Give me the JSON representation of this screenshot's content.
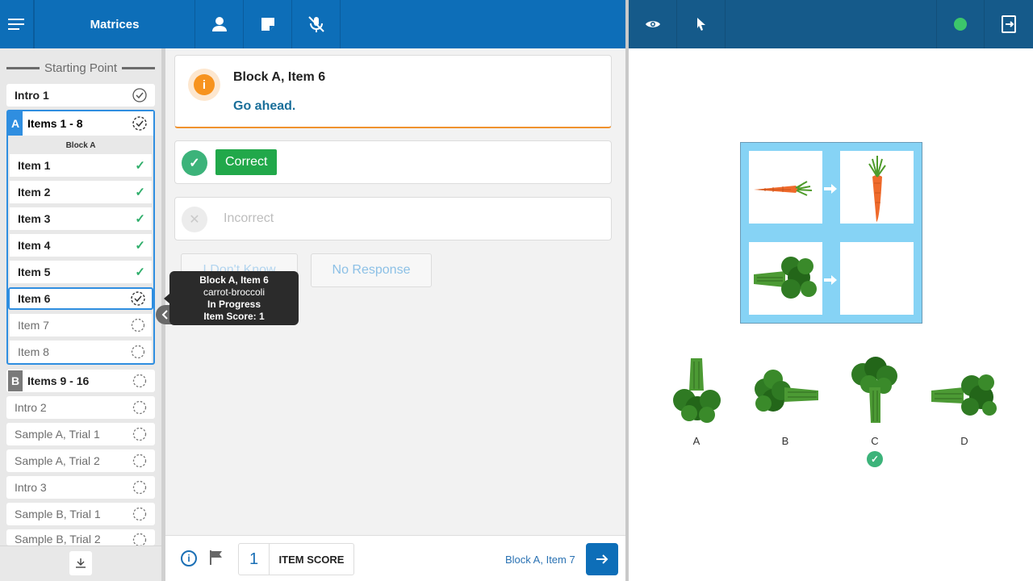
{
  "header": {
    "title": "Matrices",
    "icons": [
      "menu-icon",
      "person-icon",
      "note-icon",
      "mic-off-icon"
    ],
    "right_icons": [
      "eye-icon",
      "pointer-icon",
      "status-dot",
      "exit-icon"
    ],
    "status_color": "#3cc66b"
  },
  "sidebar": {
    "starting_point": "Starting Point",
    "intro1": "Intro 1",
    "blockA": {
      "letter": "A",
      "label": "Items 1 - 8",
      "sub": "Block A",
      "items": [
        {
          "label": "Item 1",
          "status": "done"
        },
        {
          "label": "Item 2",
          "status": "done"
        },
        {
          "label": "Item 3",
          "status": "done"
        },
        {
          "label": "Item 4",
          "status": "done"
        },
        {
          "label": "Item 5",
          "status": "done"
        },
        {
          "label": "Item 6",
          "status": "in-progress"
        },
        {
          "label": "Item 7",
          "status": "pending"
        },
        {
          "label": "Item 8",
          "status": "pending"
        }
      ]
    },
    "blockB": {
      "letter": "B",
      "label": "Items 9 - 16"
    },
    "rest": [
      "Intro 2",
      "Sample A, Trial 1",
      "Sample A, Trial 2",
      "Intro 3",
      "Sample B, Trial 1",
      "Sample B, Trial 2"
    ]
  },
  "tooltip": {
    "title": "Block A, Item 6",
    "name": "carrot-broccoli",
    "status": "In Progress",
    "score": "Item Score: 1"
  },
  "info": {
    "title": "Block A, Item 6",
    "message": "Go ahead."
  },
  "responses": {
    "correct": "Correct",
    "incorrect": "Incorrect",
    "dont_know": "I Don't Know",
    "no_response": "No Response"
  },
  "footer": {
    "score": "1",
    "score_label": "ITEM SCORE",
    "next_label": "Block A, Item 7"
  },
  "stimulus": {
    "choices": [
      "A",
      "B",
      "C",
      "D"
    ],
    "selected": "C"
  }
}
